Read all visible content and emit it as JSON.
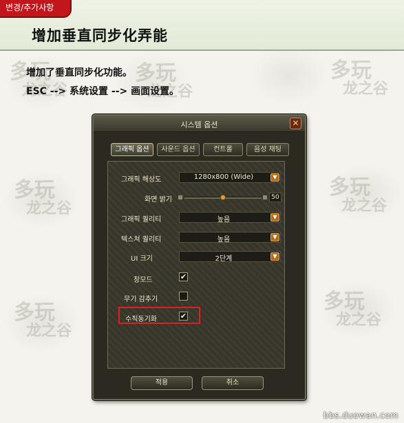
{
  "header": {
    "tag_label": "변경/추가사항",
    "title": "增加垂直同步化弄能"
  },
  "description": {
    "line1": "增加了垂直同步化功能。",
    "line2": "ESC --> 系统设置  --> 画面设置。"
  },
  "watermark": {
    "text_big": "多玩",
    "text_small": "龙之谷"
  },
  "dialog": {
    "title": "시스템 옵션",
    "close_icon": "close-icon",
    "tabs": [
      {
        "label": "그래픽 옵션",
        "active": true
      },
      {
        "label": "사운드 옵션",
        "active": false
      },
      {
        "label": "컨트롤",
        "active": false
      },
      {
        "label": "음성 채팅",
        "active": false
      }
    ],
    "settings": {
      "resolution": {
        "label": "그래픽 해상도",
        "value": "1280x800 (Wide)"
      },
      "brightness": {
        "label": "화면 밝기",
        "value": "50",
        "level": 0.5
      },
      "graphics_quality": {
        "label": "그래픽 퀄리티",
        "value": "높음"
      },
      "texture_quality": {
        "label": "텍스쳐 퀄리티",
        "value": "높음"
      },
      "ui_size": {
        "label": "UI 크기",
        "value": "2단계"
      },
      "windowed_mode": {
        "label": "창모드",
        "checked": true,
        "mark": "✔"
      },
      "hide_weapon": {
        "label": "무기 감추기",
        "checked": false,
        "mark": ""
      },
      "vsync": {
        "label": "수직동기화",
        "checked": true,
        "mark": "✔"
      }
    },
    "buttons": {
      "apply": "적용",
      "cancel": "취소"
    },
    "colors": {
      "highlight": "#e01f1f",
      "accent_orange": "#b06c1a"
    }
  },
  "credit": "bbs.duowan.com"
}
